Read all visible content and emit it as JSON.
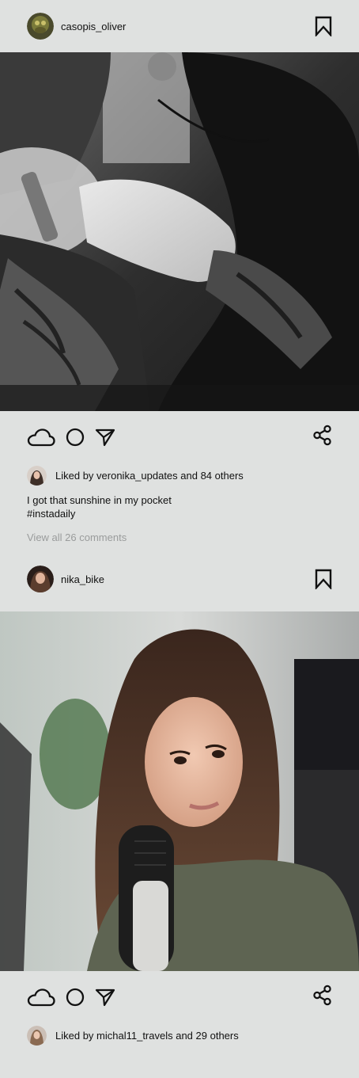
{
  "posts": [
    {
      "username": "casopis_oliver",
      "liked_by": "Liked by veronika_updates and 84 others",
      "caption_line1": "I got that sunshine in my pocket",
      "caption_line2": "#instadaily",
      "comments_link": "View all 26 comments"
    },
    {
      "username": "nika_bike",
      "liked_by": "Liked by michal11_travels and 29 others"
    }
  ],
  "icons": {
    "header_avatar": "avatar-icon",
    "bookmark": "bookmark-icon",
    "like": "cloud-like-icon",
    "comment": "circle-comment-icon",
    "send": "send-arrow-icon",
    "share": "share-nodes-icon"
  },
  "colors": {
    "background": "#dfe1e0",
    "text": "#111111",
    "muted": "#9a9c9c"
  }
}
